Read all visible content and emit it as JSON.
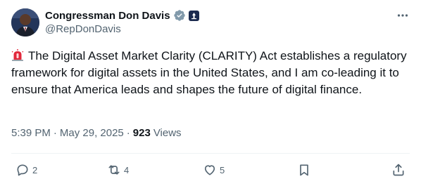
{
  "author": {
    "name": "Congressman Don Davis",
    "handle": "@RepDonDavis",
    "verified_color": "#829aab"
  },
  "post": {
    "emoji": "🚨",
    "text": "The Digital Asset Market Clarity (CLARITY) Act establishes a regulatory framework for digital assets in the United States, and I am co-leading it to ensure that America leads and shapes the future of digital finance."
  },
  "meta": {
    "time": "5:39 PM",
    "separator": "·",
    "date": "May 29, 2025",
    "views_count": "923",
    "views_label": "Views"
  },
  "actions": {
    "replies": "2",
    "reposts": "4",
    "likes": "5"
  },
  "colors": {
    "text": "#0f1419",
    "secondary": "#536471",
    "divider": "#eff3f4"
  }
}
